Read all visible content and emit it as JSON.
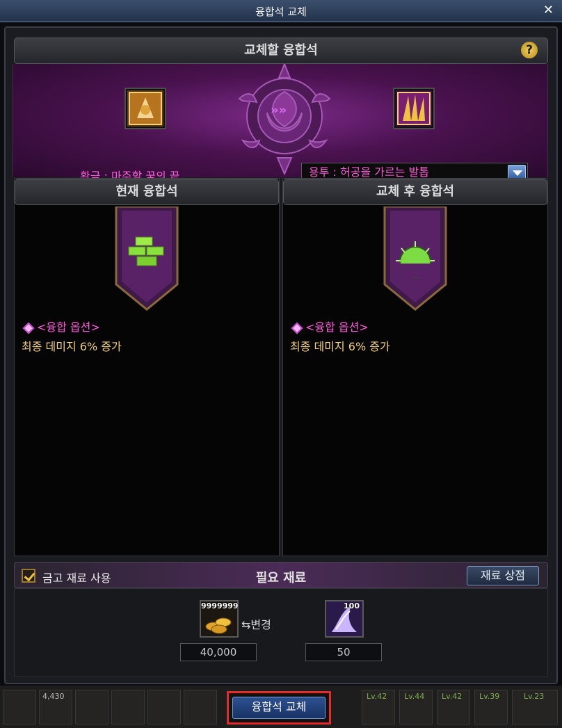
{
  "window": {
    "title": "융합석 교체",
    "close_label": "✕"
  },
  "header": {
    "title": "교체할 융합석",
    "help_label": "?"
  },
  "swap": {
    "left_item_name": "황금 : 마주할 꿈의 끝",
    "right_select_value": "용투 : 허공을 가르는 발톱"
  },
  "panels": {
    "current": {
      "title": "현재 융합석",
      "option_heading": "<융합 옵션>",
      "option_text": "최종 데미지 6% 증가"
    },
    "after": {
      "title": "교체 후 융합석",
      "option_heading": "<융합 옵션>",
      "option_text": "최종 데미지 6% 증가"
    }
  },
  "materials": {
    "title": "필요 재료",
    "use_vault_label": "금고 재료 사용",
    "use_vault_checked": true,
    "shop_button": "재료 상점",
    "items": [
      {
        "icon": "gold-coins-icon",
        "stack_label": "9999999",
        "qty": "40,000",
        "swap_label": "변경"
      },
      {
        "icon": "crystal-material-icon",
        "stack_label": "100",
        "qty": "50"
      }
    ]
  },
  "hotbar": {
    "levels": [
      "Lv.42",
      "Lv.44",
      "Lv.42",
      "Lv.39",
      "Lv.23"
    ],
    "misc_text": "4,430"
  },
  "action_button": "융합석 교체",
  "colors": {
    "accent_pink": "#ff5bd9",
    "gold_text": "#f2d080",
    "highlight_red": "#e22b2b"
  }
}
